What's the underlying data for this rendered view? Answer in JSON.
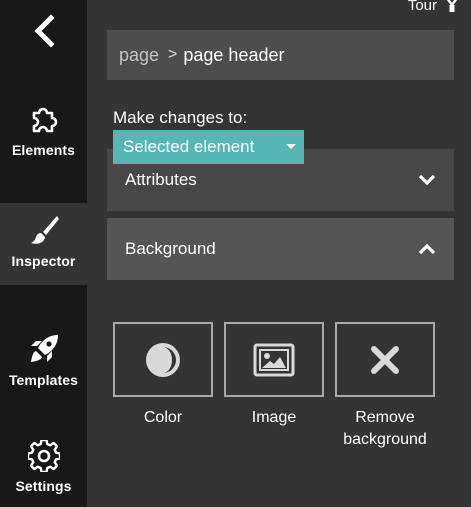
{
  "sidebar": {
    "items": [
      {
        "label": "Elements",
        "icon": "puzzle-piece-icon",
        "active": false
      },
      {
        "label": "Inspector",
        "icon": "paintbrush-icon",
        "active": true
      },
      {
        "label": "Templates",
        "icon": "rocket-icon",
        "active": false
      },
      {
        "label": "Settings",
        "icon": "gear-icon",
        "active": false
      }
    ]
  },
  "header": {
    "tour_label": "Tour"
  },
  "breadcrumb": {
    "root": "page",
    "separator": ">",
    "current": "page header"
  },
  "changes": {
    "label": "Make changes to:",
    "selected": "Selected element"
  },
  "sections": {
    "attributes": {
      "title": "Attributes",
      "expanded": false
    },
    "background": {
      "title": "Background",
      "expanded": true
    }
  },
  "background_options": {
    "color": {
      "label": "Color"
    },
    "image": {
      "label": "Image"
    },
    "remove": {
      "label_line1": "Remove",
      "label_line2": "background"
    }
  },
  "colors": {
    "accent": "#57b6b5",
    "rail_bg": "#181818",
    "panel_bg": "#343434",
    "row_bg": "#4d4d4d"
  }
}
